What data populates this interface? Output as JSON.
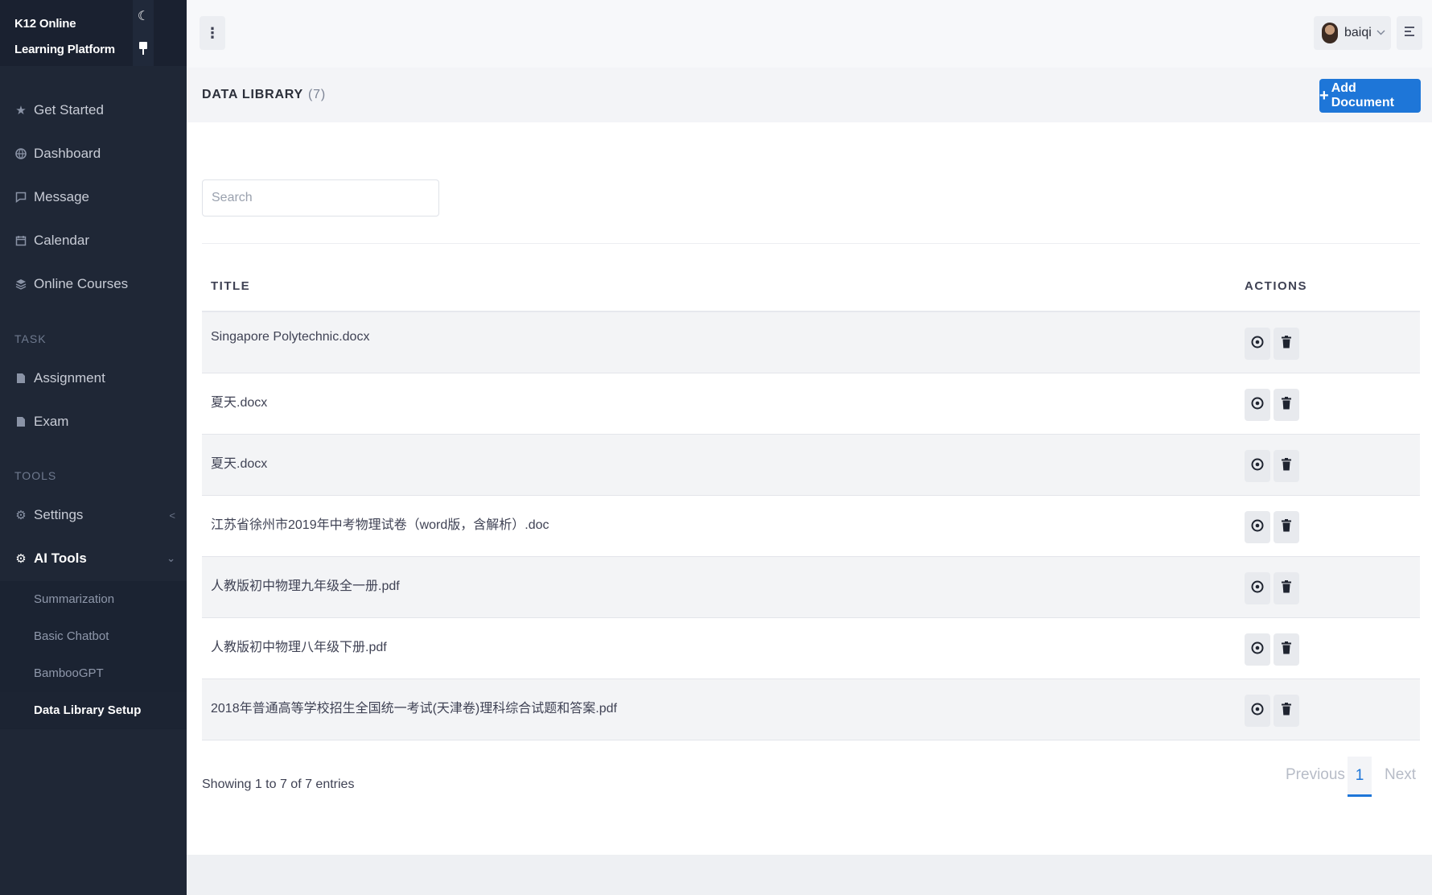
{
  "brand": {
    "title": "K12 Online Learning Platform"
  },
  "sidebar": {
    "main_items": [
      {
        "label": "Get Started",
        "icon": "star-icon"
      },
      {
        "label": "Dashboard",
        "icon": "globe-icon"
      },
      {
        "label": "Message",
        "icon": "chat-icon"
      },
      {
        "label": "Calendar",
        "icon": "calendar-icon"
      },
      {
        "label": "Online Courses",
        "icon": "layers-icon"
      }
    ],
    "task_label": "TASK",
    "task_items": [
      {
        "label": "Assignment",
        "icon": "document-icon"
      },
      {
        "label": "Exam",
        "icon": "document-icon"
      }
    ],
    "tools_label": "TOOLS",
    "tools_items": [
      {
        "label": "Settings",
        "icon": "gear-icon"
      },
      {
        "label": "AI Tools",
        "icon": "gear-icon"
      }
    ],
    "ai_tools_sub": [
      {
        "label": "Summarization"
      },
      {
        "label": "Basic Chatbot"
      },
      {
        "label": "BambooGPT"
      },
      {
        "label": "Data Library Setup"
      }
    ]
  },
  "header": {
    "user_name": "baiqi"
  },
  "toolbar": {
    "title": "DATA LIBRARY",
    "count": "(7)",
    "add_label": "Add Document"
  },
  "search": {
    "placeholder": "Search"
  },
  "table": {
    "columns": [
      "TITLE",
      "ACTIONS"
    ],
    "rows": [
      {
        "title": "Singapore Polytechnic.docx"
      },
      {
        "title": "夏天.docx"
      },
      {
        "title": "夏天.docx"
      },
      {
        "title": "江苏省徐州市2019年中考物理试卷（word版，含解析）.doc"
      },
      {
        "title": "人教版初中物理九年级全一册.pdf"
      },
      {
        "title": "人教版初中物理八年级下册.pdf"
      },
      {
        "title": "2018年普通高等学校招生全国统一考试(天津卷)理科综合试题和答案.pdf"
      }
    ]
  },
  "pagination": {
    "info": "Showing 1 to 7 of 7 entries",
    "previous": "Previous",
    "current": "1",
    "next": "Next"
  },
  "colors": {
    "accent": "#1e76d8",
    "sidebar_bg": "#1f2736"
  }
}
